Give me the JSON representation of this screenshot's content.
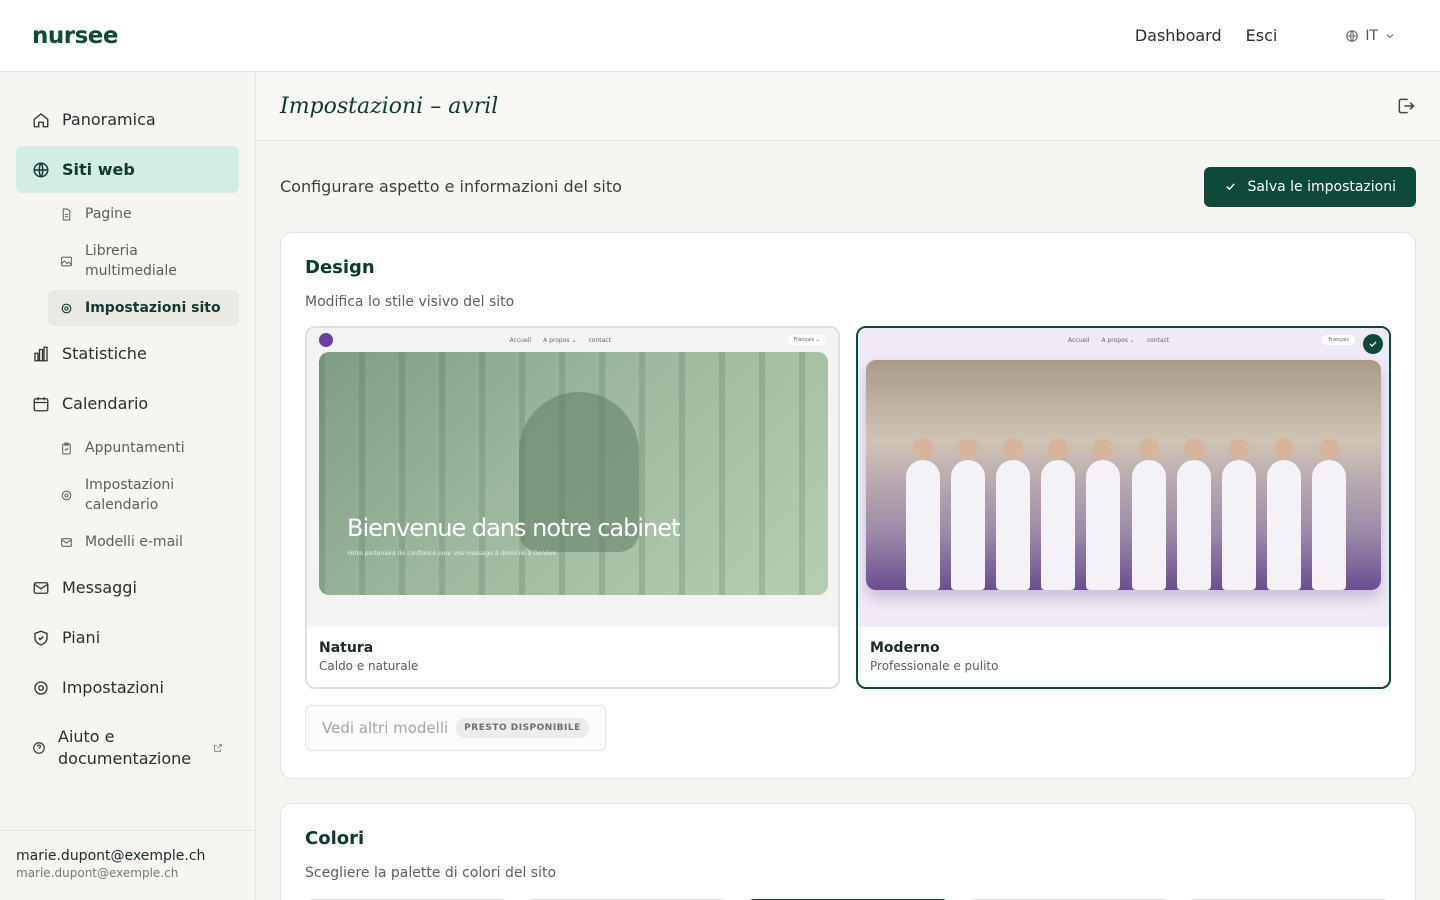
{
  "header": {
    "logo": "nursee",
    "nav": [
      "Dashboard",
      "Esci"
    ],
    "lang": "IT"
  },
  "sidebar": {
    "items": [
      {
        "label": "Panoramica",
        "icon": "home-icon"
      },
      {
        "label": "Siti web",
        "icon": "globe-icon",
        "active": true
      },
      {
        "label": "Pagine",
        "icon": "file-icon",
        "sub": true
      },
      {
        "label": "Libreria multimediale",
        "icon": "image-icon",
        "sub": true
      },
      {
        "label": "Impostazioni sito",
        "icon": "gear-icon",
        "sub": true,
        "active": true
      },
      {
        "label": "Statistiche",
        "icon": "bar-chart-icon"
      },
      {
        "label": "Calendario",
        "icon": "calendar-icon"
      },
      {
        "label": "Appuntamenti",
        "icon": "clipboard-icon",
        "sub": true
      },
      {
        "label": "Impostazioni calendario",
        "icon": "gear-icon",
        "sub": true
      },
      {
        "label": "Modelli e-mail",
        "icon": "mail-icon",
        "sub": true
      },
      {
        "label": "Messaggi",
        "icon": "mail-icon"
      },
      {
        "label": "Piani",
        "icon": "shield-icon"
      },
      {
        "label": "Impostazioni",
        "icon": "gear-icon"
      },
      {
        "label": "Aiuto e documentazione",
        "icon": "help-icon"
      }
    ],
    "user": {
      "name": "marie.dupont@exemple.ch",
      "email": "marie.dupont@exemple.ch"
    }
  },
  "main": {
    "title": "Impostazioni – avril",
    "description": "Configurare aspetto e informazioni del sito",
    "save_label": "Salva le impostazioni",
    "design": {
      "title": "Design",
      "subtitle": "Modifica lo stile visivo del sito",
      "templates": [
        {
          "name": "Natura",
          "desc": "Caldo e naturale",
          "nav": [
            "Accueil",
            "A propos ⌄",
            "contact"
          ],
          "lang": "Français ⌄",
          "hero_title": "Bienvenue dans notre cabinet",
          "hero_sub": "Votre partenaire de confiance pour vos massage à domicile à Genève"
        },
        {
          "name": "Moderno",
          "desc": "Professionale e pulito",
          "nav": [
            "Accueil",
            "A propos ⌄",
            "contact"
          ],
          "lang": "Français"
        }
      ],
      "selected": "Moderno",
      "more_label": "Vedi altri modelli",
      "soon_badge": "PRESTO DISPONIBILE"
    },
    "colors": {
      "title": "Colori",
      "subtitle": "Scegliere la palette di colori del sito",
      "palettes": [
        [
          "#e8e8e8",
          "#6fa0c8",
          "#4b5bb0",
          "#2c3e6e"
        ],
        [
          "#e5e5e5",
          "#7ec8c2",
          "#2f8a86",
          "#333333"
        ],
        [
          "#0e4a3a",
          "#2f6e58",
          "#a9cdbd",
          "#e6e1d5"
        ],
        [
          "#eeeeee",
          "#f0d36a",
          "#c7a24a",
          "#4a3a22"
        ],
        [
          "#e0dcd8",
          "#d9b9a8",
          "#a27a60",
          "#3a2a22"
        ]
      ],
      "accent": "#0e4a3a"
    }
  }
}
